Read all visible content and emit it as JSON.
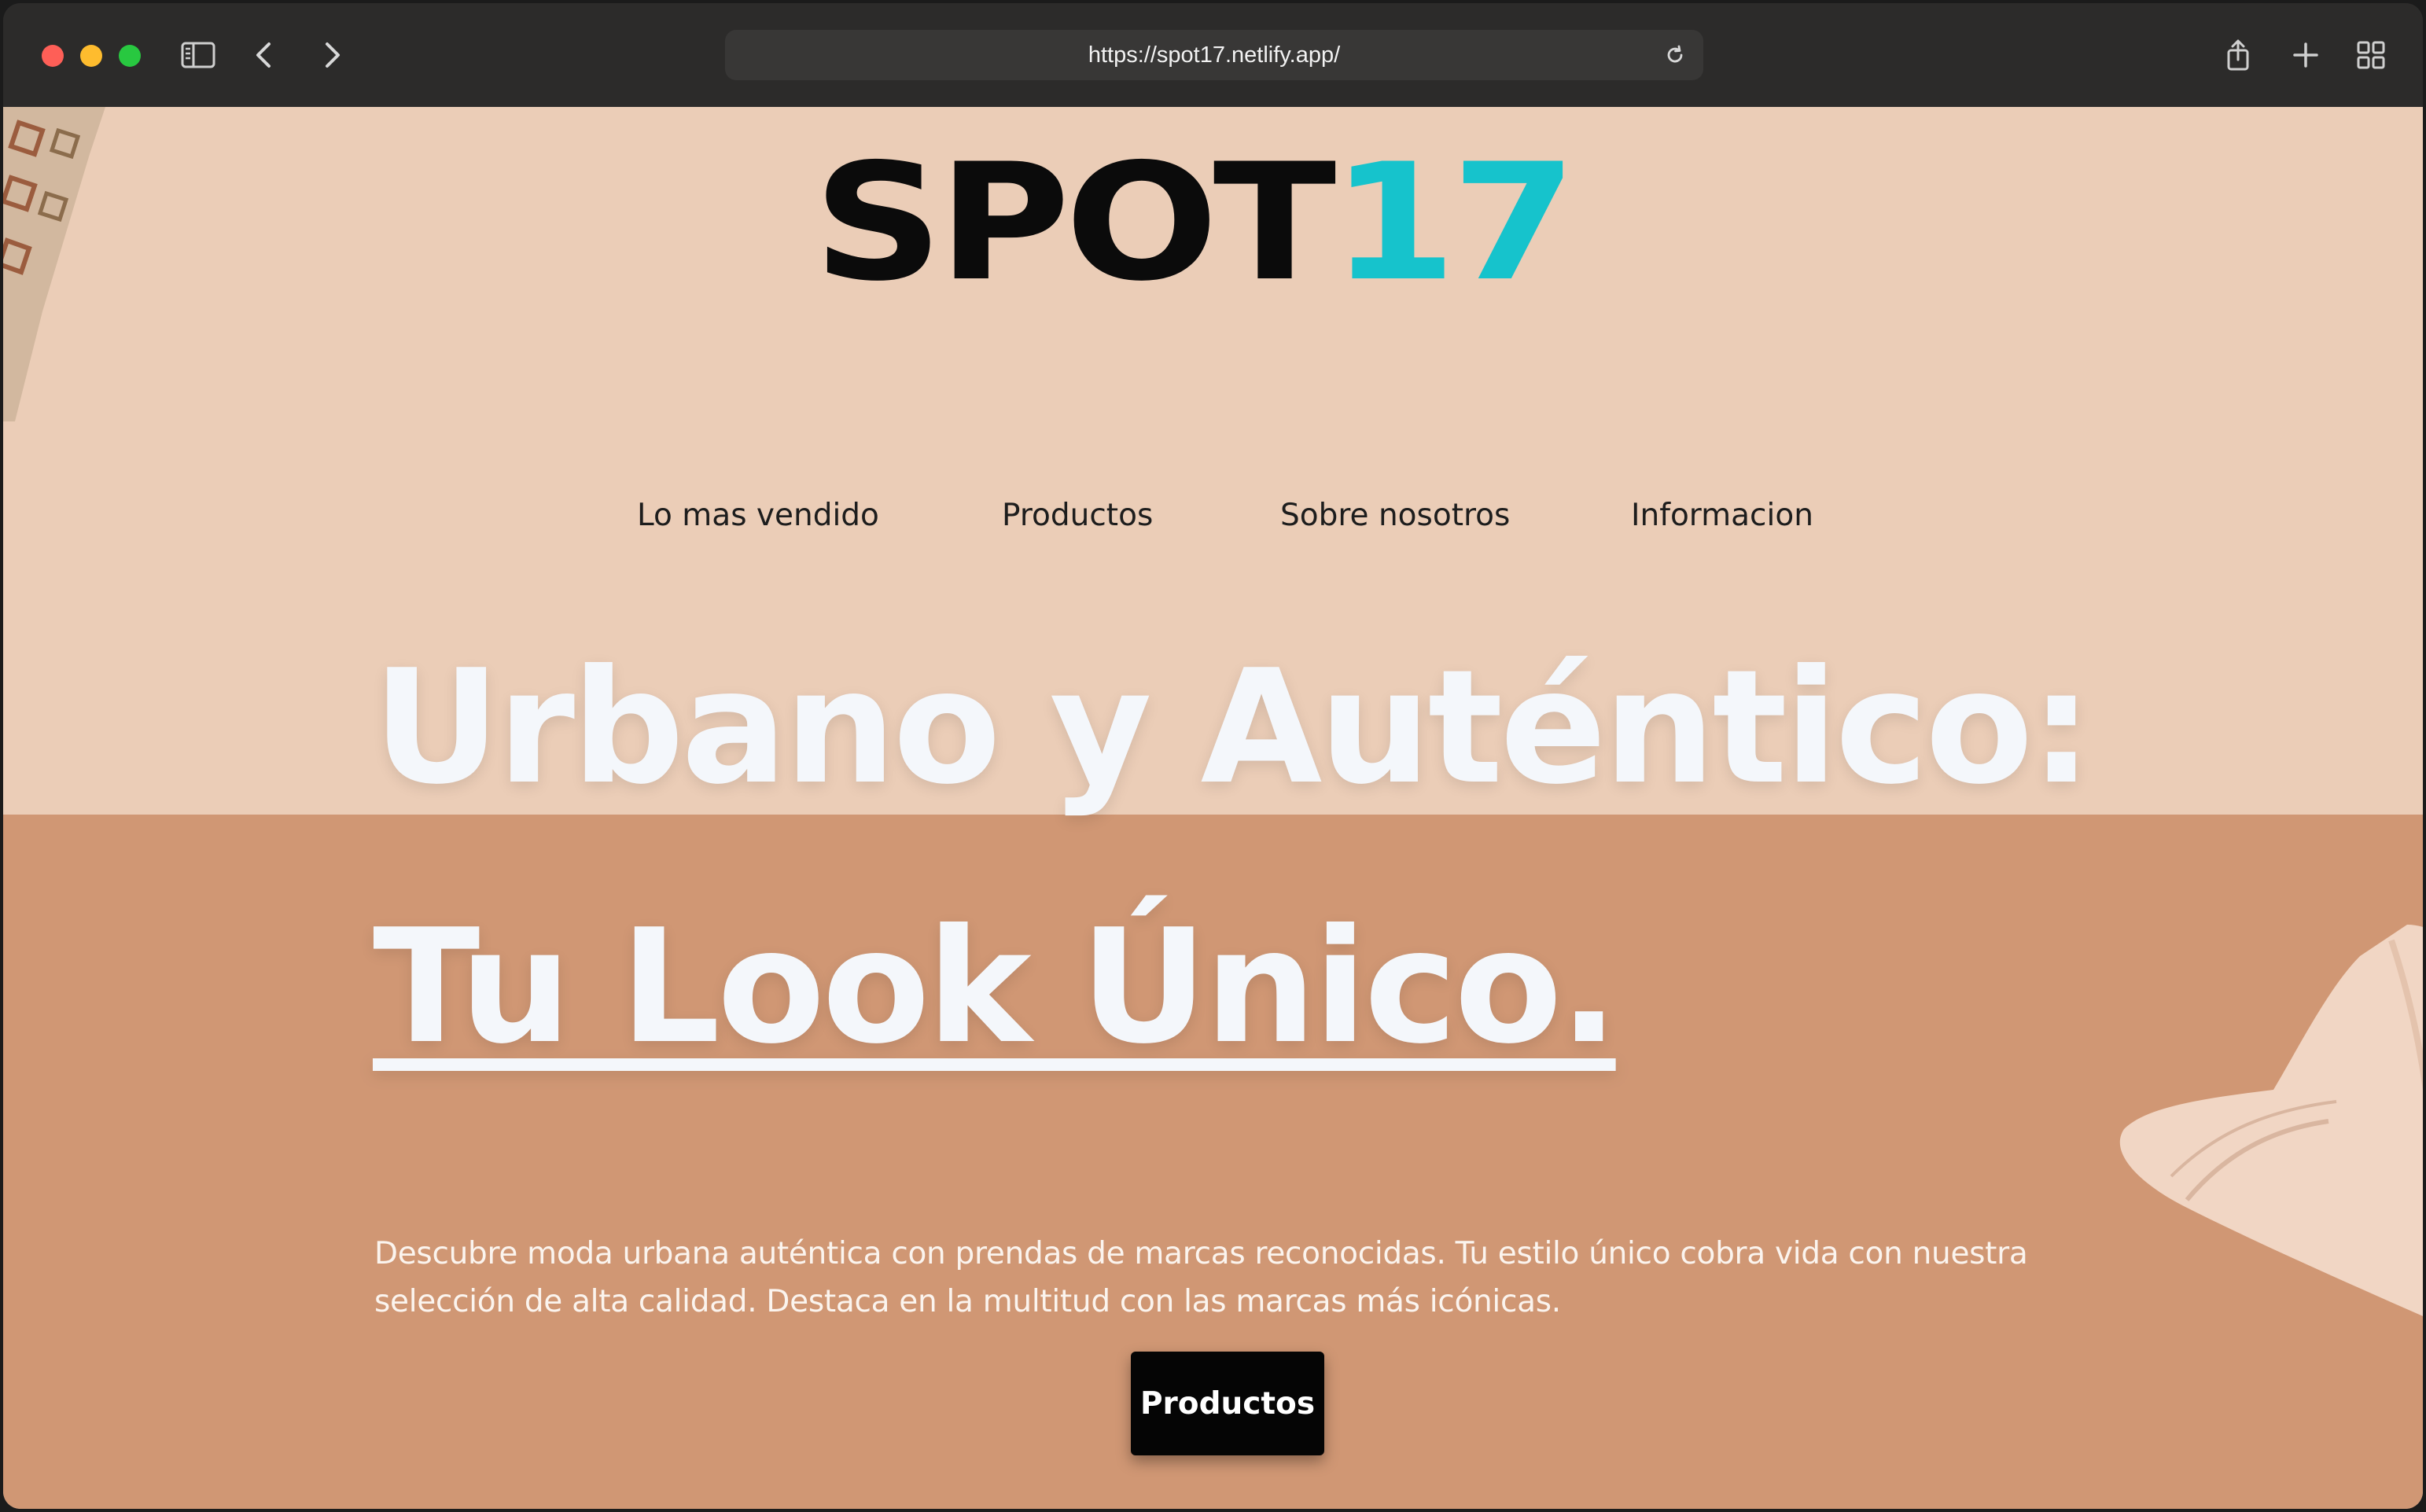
{
  "browser": {
    "url": "https://spot17.netlify.app/",
    "icons": [
      "sidebar-icon",
      "back-icon",
      "forward-icon",
      "reload-icon",
      "share-icon",
      "new-tab-icon",
      "tab-overview-icon"
    ]
  },
  "site": {
    "logo_part1": "SPOT",
    "logo_part2": "17",
    "colors": {
      "background_top": "#ebcdb7",
      "background_bottom": "#d09774",
      "accent": "#16c3cc",
      "text_dark": "#0b0b0b"
    }
  },
  "nav": {
    "items": [
      {
        "label": "Lo mas vendido"
      },
      {
        "label": "Productos"
      },
      {
        "label": "Sobre nosotros"
      },
      {
        "label": "Informacion"
      }
    ]
  },
  "hero": {
    "headline_1": "Urbano y Auténtico:",
    "headline_2": "Tu Look Único.",
    "description": "Descubre moda urbana auténtica con prendas de marcas reconocidas. Tu estilo único cobra vida con nuestra selección de alta calidad. Destaca en la multitud con las marcas más icónicas.",
    "cta_label": "Productos"
  }
}
